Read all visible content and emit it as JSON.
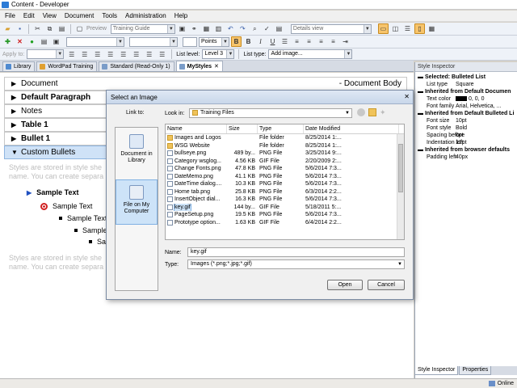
{
  "window": {
    "title": "Content - Developer"
  },
  "menu": [
    "File",
    "Edit",
    "View",
    "Document",
    "Tools",
    "Administration",
    "Help"
  ],
  "toolbar1": {
    "preview_label": "Preview",
    "doc_combo": "Training Guide",
    "view_combo": "Details view"
  },
  "toolbar2": {
    "font_size_unit": "Points"
  },
  "toolbar3": {
    "apply_to_label": "Apply to:",
    "list_level_label": "List level:",
    "list_level_value": "Level 3",
    "list_type_label": "List type:",
    "list_type_value": "Add image..."
  },
  "tabs": [
    {
      "label": "Library"
    },
    {
      "label": "WordPad Training"
    },
    {
      "label": "Standard (Read-Only 1)"
    },
    {
      "label": "MyStyles"
    }
  ],
  "styles": [
    {
      "label": "Document",
      "right": "- Document Body",
      "arrow": "▶"
    },
    {
      "label": "Default Paragraph",
      "arrow": "▶"
    },
    {
      "label": "Notes",
      "arrow": "▶"
    },
    {
      "label": "Table 1",
      "arrow": "▶"
    },
    {
      "label": "Bullet 1",
      "arrow": "▶"
    },
    {
      "label": "Custom Bullets",
      "arrow": "▼"
    }
  ],
  "preview": {
    "grey1": "Styles are stored in style she",
    "grey2": "name. You can create separa",
    "bullets": [
      "Sample Text",
      "Sample Text",
      "Sample Text",
      "Sample",
      "Sa"
    ]
  },
  "inspector": {
    "title": "Style Inspector",
    "selected": "Selected: Bulleted List",
    "list_type_k": "List type",
    "list_type_v": "Square",
    "h2": "Inherited from Default Documen",
    "text_color_k": "Text color",
    "text_color_v": "0, 0, 0",
    "font_family_k": "Font family",
    "font_family_v": "Arial, Helvetica, ...",
    "h3": "Inherited from Default Bulleted Li",
    "font_size_k": "Font size",
    "font_size_v": "10pt",
    "font_style_k": "Font style",
    "font_style_v": "Bold",
    "spacing_k": "Spacing before",
    "spacing_v": "6pt",
    "indent_k": "Indentation left",
    "indent_v": "12pt",
    "h4": "Inherited from browser defaults",
    "padding_k": "Padding left",
    "padding_v": "40px",
    "tab1": "Style Inspector",
    "tab2": "Properties"
  },
  "status": {
    "text": "Online"
  },
  "dialog": {
    "title": "Select an Image",
    "link_to": "Link to:",
    "look_in": "Look in:",
    "look_in_value": "Training Files",
    "places": [
      {
        "label": "Document in Library"
      },
      {
        "label": "File on My Computer"
      }
    ],
    "columns": [
      "Name",
      "Size",
      "Type",
      "Date Modified"
    ],
    "files": [
      {
        "name": "Images and Logos",
        "size": "",
        "type": "File folder",
        "date": "8/25/2014 1:...",
        "folder": true
      },
      {
        "name": "WSG Website",
        "size": "",
        "type": "File folder",
        "date": "8/25/2014 1:...",
        "folder": true
      },
      {
        "name": "bullseye.png",
        "size": "489 by...",
        "type": "PNG File",
        "date": "3/25/2014 9:..."
      },
      {
        "name": "Category wsglog...",
        "size": "4.56 KB",
        "type": "GIF File",
        "date": "2/20/2009 2:..."
      },
      {
        "name": "Change Fonts.png",
        "size": "47.8 KB",
        "type": "PNG File",
        "date": "5/6/2014 7:3..."
      },
      {
        "name": "DateMemo.png",
        "size": "41.1 KB",
        "type": "PNG File",
        "date": "5/6/2014 7:3..."
      },
      {
        "name": "DateTime dialog....",
        "size": "10.3 KB",
        "type": "PNG File",
        "date": "5/6/2014 7:3..."
      },
      {
        "name": "Home tab.png",
        "size": "25.8 KB",
        "type": "PNG File",
        "date": "6/3/2014 2:2..."
      },
      {
        "name": "InsertObject dial...",
        "size": "16.3 KB",
        "type": "PNG File",
        "date": "5/6/2014 7:3..."
      },
      {
        "name": "key.gif",
        "size": "144 by...",
        "type": "GIF File",
        "date": "5/18/2011 5:...",
        "selected": true
      },
      {
        "name": "PageSetup.png",
        "size": "19.5 KB",
        "type": "PNG File",
        "date": "5/6/2014 7:3..."
      },
      {
        "name": "Prototype option...",
        "size": "1.63 KB",
        "type": "GIF File",
        "date": "6/4/2014 2:2..."
      }
    ],
    "name_label": "Name:",
    "name_value": "key.gif",
    "type_label": "Type:",
    "type_value": "Images (*.png;*.jpg;*.gif)",
    "open": "Open",
    "cancel": "Cancel"
  }
}
